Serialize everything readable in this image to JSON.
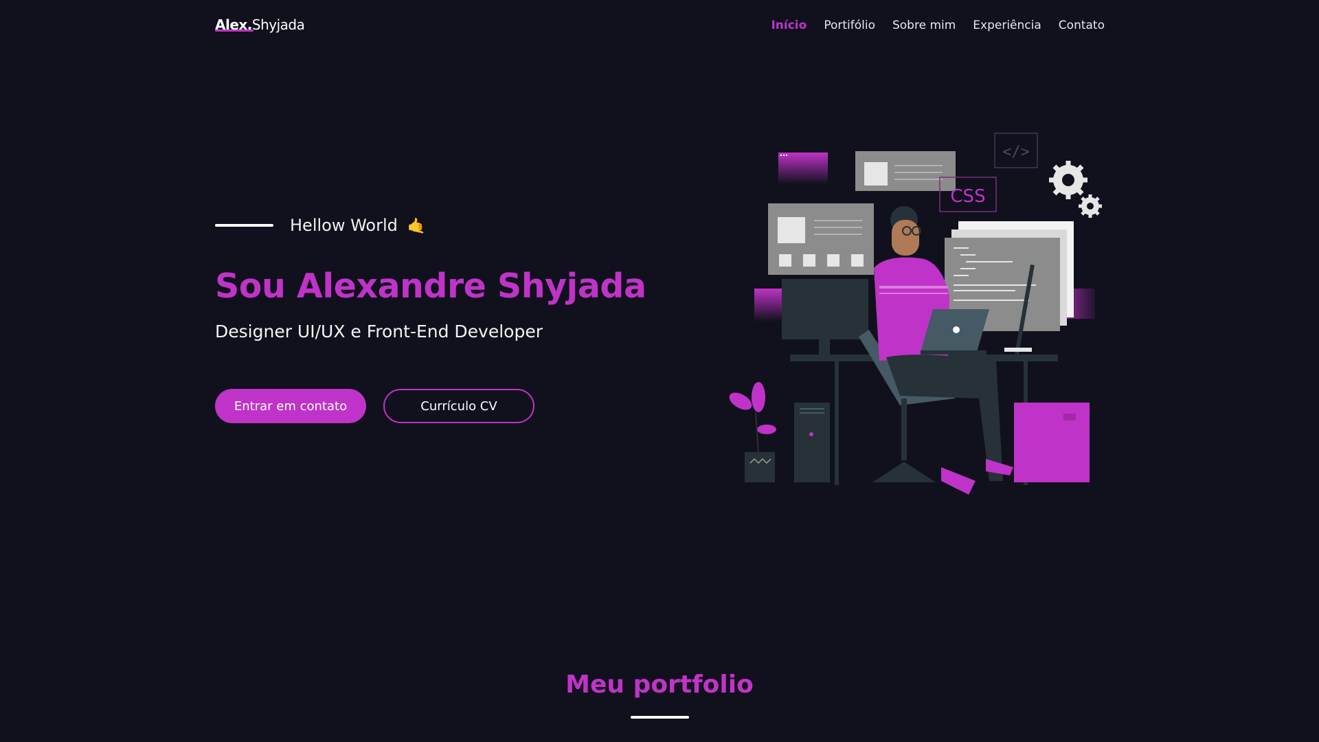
{
  "header": {
    "logo_first": "Alex.",
    "logo_last": "Shyjada",
    "nav": [
      {
        "label": "Início",
        "active": true
      },
      {
        "label": "Portifólio",
        "active": false
      },
      {
        "label": "Sobre mim",
        "active": false
      },
      {
        "label": "Experiência",
        "active": false
      },
      {
        "label": "Contato",
        "active": false
      }
    ]
  },
  "hero": {
    "greeting": "Hellow World",
    "greeting_emoji": "🤙",
    "title": "Sou Alexandre Shyjada",
    "subtitle": "Designer UI/UX e Front-End Developer",
    "primary_button": "Entrar em contato",
    "secondary_button": "Currículo CV"
  },
  "illustration": {
    "icon": "developer-at-desk-illustration",
    "css_tag": "CSS",
    "code_tag": "</>"
  },
  "portfolio": {
    "title": "Meu portfolio"
  },
  "colors": {
    "background": "#11111d",
    "accent": "#c033c8",
    "text": "#ffffff"
  }
}
